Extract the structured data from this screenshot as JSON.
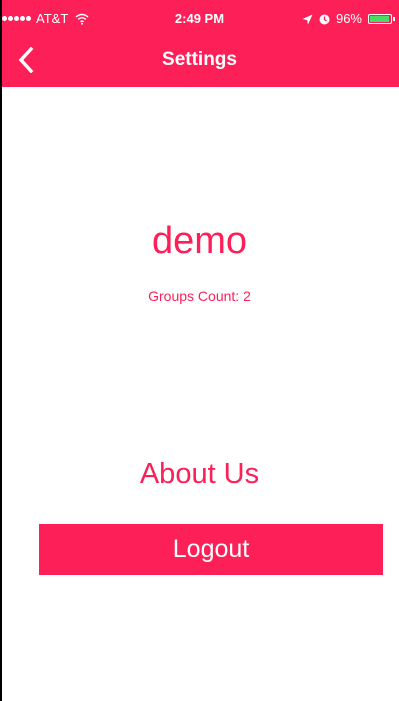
{
  "status_bar": {
    "carrier": "AT&T",
    "time": "2:49 PM",
    "battery_percent": "96%",
    "battery_level": 0.96
  },
  "nav": {
    "title": "Settings",
    "back_icon": "chevron-left-icon"
  },
  "profile": {
    "username": "demo",
    "groups_count": "Groups Count: 2"
  },
  "actions": {
    "about_label": "About Us",
    "logout_label": "Logout"
  },
  "colors": {
    "accent": "#fc1f58",
    "text_on_accent": "#ffffff",
    "background": "#ffffff",
    "battery_fill": "#4cd964"
  }
}
